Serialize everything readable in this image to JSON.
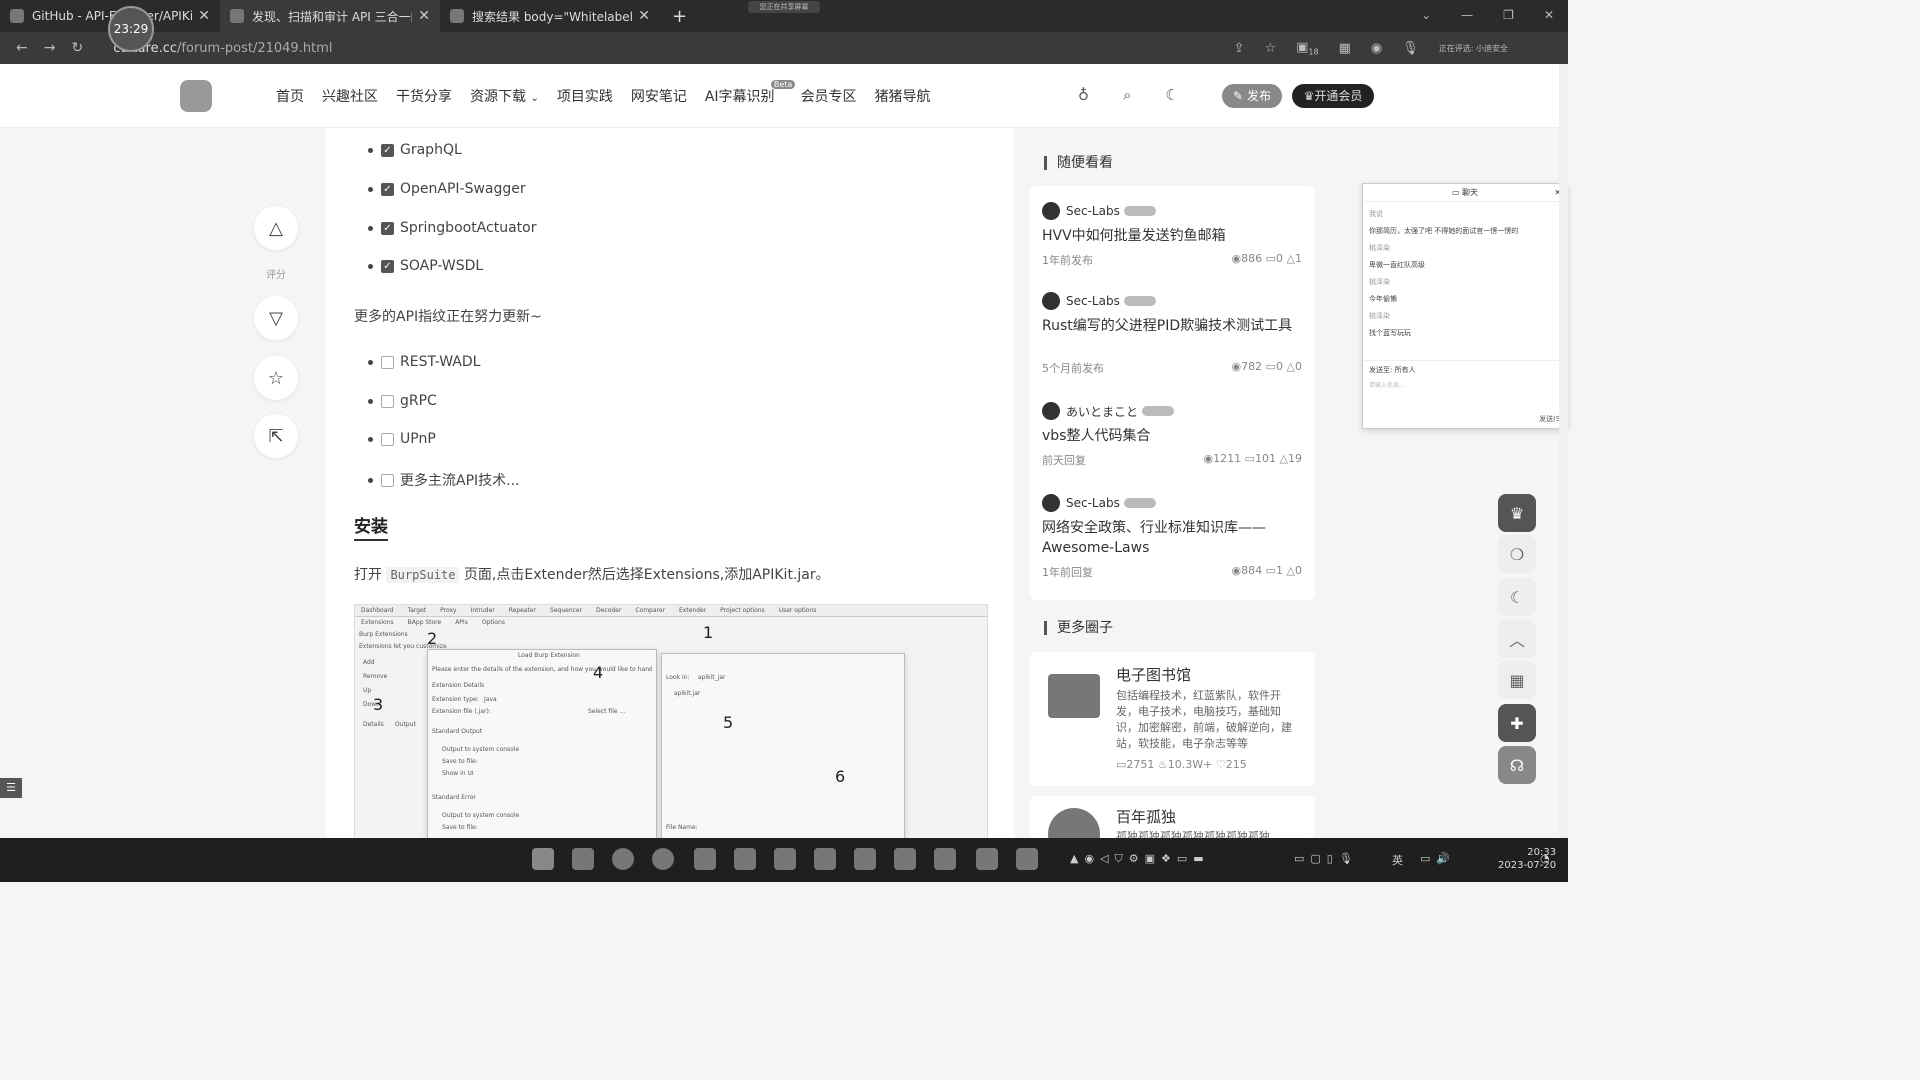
{
  "browser": {
    "tabs": [
      {
        "title": "GitHub - API-Explorer/APIKit: /"
      },
      {
        "title": "发现、扫描和审计 API 三合一的"
      },
      {
        "title": "搜索结果 body=\"Whitelabel Er"
      }
    ],
    "share_badge": "您正在共享屏幕",
    "url_host": "culture.cc",
    "url_path": "/forum-post/21049.html",
    "recording_time": "23:29",
    "toolbar_count": "18",
    "toolbar_status": "正在评选: 小迪安全"
  },
  "site": {
    "nav": [
      "首页",
      "兴趣社区",
      "干货分享",
      "资源下载",
      "项目实践",
      "网安笔记",
      "AI字幕识别",
      "会员专区",
      "猪猪导航"
    ],
    "nav_dropdown_icon": "chevron-down-icon",
    "beta_label": "Beta",
    "publish_button": "发布",
    "vip_button": "开通会员"
  },
  "left_actions": {
    "rating_label": "评分"
  },
  "article": {
    "checked_items": [
      "GraphQL",
      "OpenAPI-Swagger",
      "SpringbootActuator",
      "SOAP-WSDL"
    ],
    "more_text": "更多的API指纹正在努力更新~",
    "unchecked_items": [
      "REST-WADL",
      "gRPC",
      "UPnP",
      "更多主流API技术..."
    ],
    "install_heading": "安装",
    "install_text_before": "打开 ",
    "install_code": "BurpSuite",
    "install_text_after": " 页面,点击Extender然后选择Extensions,添加APIKit.jar。",
    "screenshot": {
      "menu": [
        "Dashboard",
        "Target",
        "Proxy",
        "Intruder",
        "Repeater",
        "Sequencer",
        "Decoder",
        "Comparer",
        "Extender",
        "Project options",
        "User options"
      ],
      "submenu": [
        "Extensions",
        "BApp Store",
        "APIs",
        "Options"
      ],
      "dialog_title": "Load Burp Extension",
      "dialog_hint": "Please enter the details of the extension, and how you would like to handle standard output",
      "ext_details": "Extension Details",
      "ext_type_label": "Extension type:",
      "ext_type_value": "Java",
      "ext_file_label": "Extension file (.jar):",
      "select_file": "Select file ...",
      "std_output": "Standard Output",
      "out_console": "Output to system console",
      "save_file": "Save to file:",
      "show_ui": "Show in UI",
      "std_error": "Standard Error",
      "look_in_label": "Look in:",
      "look_in_value": "apikit_jar",
      "file_item": "apikit.jar",
      "file_name_label": "File Name:",
      "burp_ext": "Burp Extensions",
      "burp_ext_desc": "Extensions let you customize",
      "buttons": [
        "Add",
        "Remove",
        "Up",
        "Down"
      ],
      "detail_tabs": [
        "Details",
        "Output"
      ],
      "numbers": [
        "1",
        "2",
        "3",
        "4",
        "5",
        "6"
      ]
    }
  },
  "sidebar": {
    "random_heading": "随便看看",
    "posts": [
      {
        "author": "Sec-Labs",
        "title": "HVV中如何批量发送钓鱼邮箱",
        "time": "1年前发布",
        "views": "886",
        "comments": "0",
        "likes": "1"
      },
      {
        "author": "Sec-Labs",
        "title": "Rust编写的父进程PID欺骗技术测试工具",
        "time": "5个月前发布",
        "views": "782",
        "comments": "0",
        "likes": "0"
      },
      {
        "author": "あいとまこと",
        "title": "vbs整人代码集合",
        "time": "前天回复",
        "views": "1211",
        "comments": "101",
        "likes": "19"
      },
      {
        "author": "Sec-Labs",
        "title": "网络安全政策、行业标准知识库——Awesome-Laws",
        "time": "1年前回复",
        "views": "884",
        "comments": "1",
        "likes": "0"
      }
    ],
    "circles_heading": "更多圈子",
    "circles": [
      {
        "name": "电子图书馆",
        "desc": "包括编程技术，红蓝紫队，软件开发，电子技术，电脑技巧，基础知识，加密解密，前端，破解逆向，建站，软技能，电子杂志等等",
        "posts": "2751",
        "hot": "10.3W+",
        "likes": "215"
      },
      {
        "name": "百年孤独",
        "desc": "孤独孤独孤独孤独孤独孤独孤独"
      }
    ]
  },
  "chat": {
    "title": "聊天",
    "lines": [
      {
        "name": "我说",
        "text": "你那简历，太强了吧  不得她的面试官一愣一愣的"
      },
      {
        "name": "桃泽染",
        "text": "卑微一直红队高级"
      },
      {
        "name": "桃泽染",
        "text": "今年偷懒"
      },
      {
        "name": "桃泽染",
        "text": "找个蓝写玩玩"
      }
    ],
    "send_to_label": "发送至:",
    "send_to_value": "所有人",
    "input_placeholder": "请输入信息...",
    "send_button": "发送(S)"
  },
  "taskbar": {
    "lang": "英",
    "time": "20:33",
    "date": "2023-07-20"
  }
}
